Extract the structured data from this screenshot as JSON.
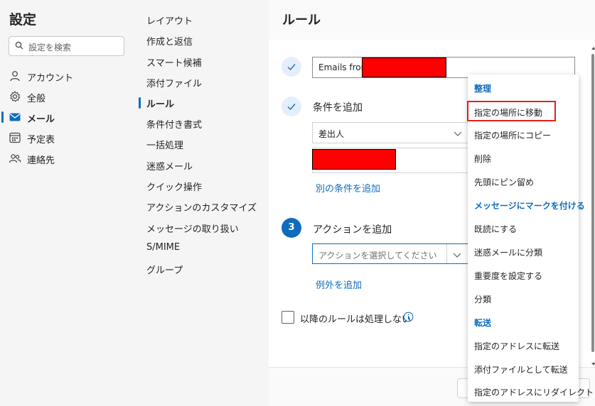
{
  "sidebar": {
    "title": "設定",
    "search_placeholder": "設定を検索",
    "categories": [
      {
        "label": "アカウント",
        "icon": "person-icon"
      },
      {
        "label": "全般",
        "icon": "gear-icon"
      },
      {
        "label": "メール",
        "icon": "mail-icon",
        "selected": true
      },
      {
        "label": "予定表",
        "icon": "calendar-icon"
      },
      {
        "label": "連絡先",
        "icon": "people-icon"
      }
    ]
  },
  "submenu": {
    "items": [
      "レイアウト",
      "作成と返信",
      "スマート候補",
      "添付ファイル",
      "ルール",
      "条件付き書式",
      "一括処理",
      "迷惑メール",
      "クイック操作",
      "アクションのカスタマイズ",
      "メッセージの取り扱い",
      "S/MIME",
      "グループ"
    ],
    "selected": "ルール"
  },
  "rule_editor": {
    "title": "ルール",
    "rule_name_value": "Emails from",
    "step1_icon": "checkmark-icon",
    "step2_icon": "checkmark-icon",
    "conditions_title": "条件を追加",
    "condition_select_value": "差出人",
    "add_condition_link": "別の条件を追加",
    "step3_number": "3",
    "actions_title": "アクションを追加",
    "action_select_placeholder": "アクションを選択してください",
    "add_exception_link": "例外を追加",
    "stop_processing_label": "以降のルールは処理しない",
    "stop_processing_checked": false
  },
  "action_menu": {
    "groups": [
      {
        "header": "整理",
        "items": [
          "指定の場所に移動",
          "指定の場所にコピー",
          "削除",
          "先頭にピン留め"
        ]
      },
      {
        "header": "メッセージにマークを付ける",
        "items": [
          "既読にする",
          "迷惑メールに分類",
          "重要度を設定する",
          "分類"
        ]
      },
      {
        "header": "転送",
        "items": [
          "指定のアドレスに転送",
          "添付ファイルとして転送",
          "指定のアドレスにリダイレクト"
        ]
      }
    ],
    "highlighted": "指定の場所に移動"
  },
  "colors": {
    "accent": "#0f6cbd",
    "redaction": "#ff0000",
    "highlight_border": "#e0201c"
  }
}
